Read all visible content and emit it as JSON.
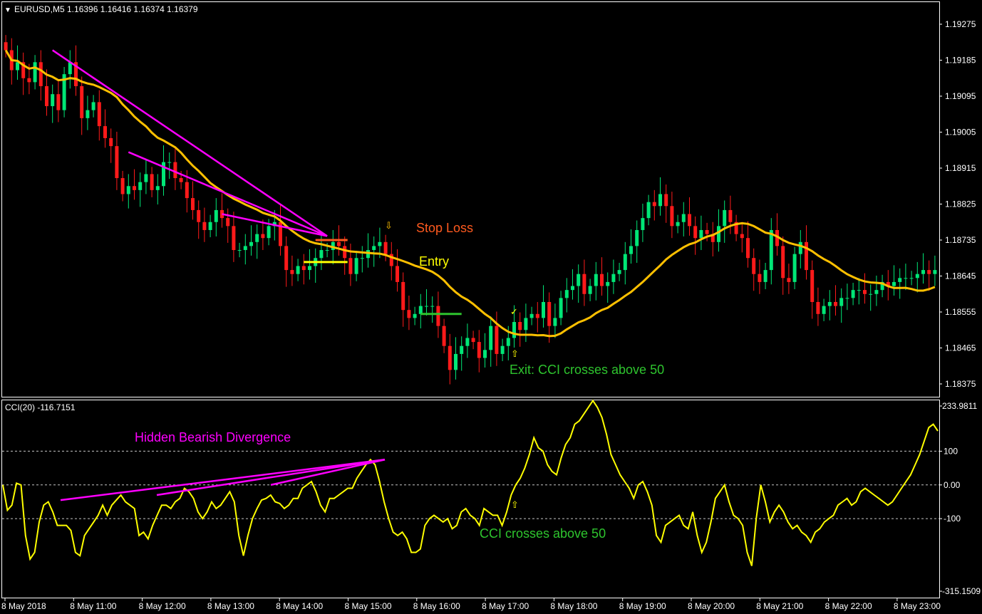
{
  "header": {
    "title": "EURUSD,M5  1.16396 1.16416 1.16374 1.16379",
    "title_arrow": "▼"
  },
  "colors": {
    "bull": "#00e676",
    "bear": "#ff1a1a",
    "ma": "#ffc000",
    "divergence": "#ff00ff",
    "cci": "#ffff00",
    "stop_loss": "#ff5a1f",
    "entry": "#ffff00",
    "exit": "#2ec42e",
    "levels": "#c8c8c8"
  },
  "annotations": {
    "stop_loss": "Stop Loss",
    "entry": "Entry",
    "exit": "Exit: CCI crosses above 50",
    "hidden_divergence": "Hidden Bearish Divergence",
    "cci_cross": "CCI crosses above 50",
    "down_arrow": "⇩",
    "up_arrow": "⇧",
    "check": "✓"
  },
  "chart_data": [
    {
      "type": "candlestick",
      "symbol": "EURUSD",
      "timeframe": "M5",
      "ohlc_header": {
        "open": 1.16396,
        "high": 1.16416,
        "low": 1.16374,
        "close": 1.16379
      },
      "price_axis_labels": [
        "1.19275",
        "1.19185",
        "1.19095",
        "1.19005",
        "1.18915",
        "1.18825",
        "1.18735",
        "1.18645",
        "1.18555",
        "1.18465",
        "1.18375"
      ],
      "time_axis_labels": [
        "8 May 2018",
        "8 May 11:00",
        "8 May 12:00",
        "8 May 13:00",
        "8 May 14:00",
        "8 May 15:00",
        "8 May 16:00",
        "8 May 17:00",
        "8 May 18:00",
        "8 May 19:00",
        "8 May 20:00",
        "8 May 21:00",
        "8 May 22:00",
        "8 May 23:00"
      ],
      "ylim": [
        1.1835,
        1.1935
      ],
      "closes": [
        1.1921,
        1.1916,
        1.1918,
        1.1914,
        1.1913,
        1.1918,
        1.1912,
        1.1907,
        1.191,
        1.1906,
        1.1915,
        1.1918,
        1.1912,
        1.1904,
        1.1906,
        1.1908,
        1.1902,
        1.1899,
        1.1897,
        1.1889,
        1.1885,
        1.1887,
        1.1886,
        1.1888,
        1.189,
        1.1886,
        1.1887,
        1.1893,
        1.1893,
        1.1889,
        1.1888,
        1.1884,
        1.1881,
        1.1878,
        1.1876,
        1.1878,
        1.1881,
        1.1879,
        1.1877,
        1.1871,
        1.1871,
        1.1872,
        1.1873,
        1.1875,
        1.1874,
        1.1877,
        1.1878,
        1.1872,
        1.1866,
        1.1865,
        1.1867,
        1.1866,
        1.1867,
        1.1869,
        1.1871,
        1.1871,
        1.1873,
        1.1872,
        1.1869,
        1.1865,
        1.1869,
        1.1869,
        1.1871,
        1.1872,
        1.1873,
        1.187,
        1.1867,
        1.1863,
        1.1856,
        1.1854,
        1.1855,
        1.1857,
        1.1857,
        1.1857,
        1.1852,
        1.1847,
        1.1841,
        1.1845,
        1.1847,
        1.1849,
        1.1848,
        1.1844,
        1.1846,
        1.1852,
        1.1845,
        1.1847,
        1.1849,
        1.1853,
        1.1851,
        1.1854,
        1.1855,
        1.1854,
        1.1858,
        1.1852,
        1.1854,
        1.1859,
        1.1861,
        1.1862,
        1.1865,
        1.186,
        1.1862,
        1.1865,
        1.1862,
        1.1863,
        1.1865,
        1.1866,
        1.187,
        1.1872,
        1.1876,
        1.1879,
        1.1883,
        1.1882,
        1.1885,
        1.1882,
        1.1877,
        1.1878,
        1.188,
        1.1877,
        1.1874,
        1.1876,
        1.1875,
        1.1873,
        1.1877,
        1.1881,
        1.1878,
        1.1875,
        1.1874,
        1.1869,
        1.1865,
        1.1863,
        1.1866,
        1.1876,
        1.1872,
        1.1864,
        1.1863,
        1.187,
        1.1873,
        1.1866,
        1.1858,
        1.1855,
        1.1857,
        1.1858,
        1.1857,
        1.1859,
        1.1859,
        1.1861,
        1.1861,
        1.186,
        1.186,
        1.1861,
        1.1863,
        1.1862,
        1.1863,
        1.1864,
        1.1864,
        1.1864,
        1.1865,
        1.1866,
        1.1865,
        1.1866
      ],
      "ma_label": "moving average",
      "divergence_trendlines": 3,
      "stop_loss_price": 1.18735,
      "entry_price": 1.1868,
      "exit_price": 1.1855
    },
    {
      "type": "line",
      "title": "CCI(20) -116.7151",
      "indicator": "CCI",
      "period": 20,
      "current_value": -116.7151,
      "axis_labels": [
        "233.9811",
        "100",
        "0.00",
        "-100",
        "-315.1509"
      ],
      "levels": [
        100,
        0,
        -100
      ],
      "ylim": [
        -315.1509,
        233.9811
      ],
      "values": [
        0,
        -75,
        -60,
        5,
        0,
        -150,
        -220,
        -200,
        -110,
        -60,
        -50,
        -80,
        -120,
        -120,
        -120,
        -135,
        -200,
        -210,
        -150,
        -130,
        -110,
        -90,
        -60,
        -90,
        -60,
        -45,
        -30,
        -50,
        -60,
        -70,
        -150,
        -140,
        -160,
        -120,
        -90,
        -60,
        -60,
        -70,
        -50,
        -40,
        -10,
        -20,
        -40,
        -80,
        -100,
        -80,
        -50,
        -70,
        -60,
        -40,
        -20,
        -50,
        -150,
        -210,
        -150,
        -100,
        -70,
        -45,
        -40,
        -30,
        -50,
        -55,
        -70,
        -60,
        -40,
        -40,
        -10,
        0,
        10,
        -20,
        -60,
        -80,
        -40,
        -40,
        -30,
        -20,
        -10,
        -10,
        20,
        40,
        60,
        75,
        60,
        10,
        -50,
        -100,
        -140,
        -150,
        -140,
        -160,
        -200,
        -200,
        -190,
        -120,
        -100,
        -90,
        -100,
        -110,
        -100,
        -130,
        -120,
        -80,
        -70,
        -90,
        -100,
        -120,
        -70,
        -80,
        -90,
        -90,
        -120,
        -80,
        -30,
        0,
        20,
        50,
        90,
        140,
        110,
        100,
        60,
        40,
        30,
        80,
        120,
        140,
        180,
        190,
        210,
        230,
        250,
        230,
        200,
        150,
        90,
        60,
        30,
        10,
        -10,
        -40,
        0,
        10,
        -20,
        -60,
        -150,
        -170,
        -120,
        -110,
        -100,
        -90,
        -120,
        -130,
        -80,
        -150,
        -200,
        -170,
        -110,
        -40,
        -20,
        0,
        -50,
        -90,
        -100,
        -120,
        -200,
        -240,
        -100,
        0,
        -50,
        -110,
        -80,
        -60,
        -80,
        -110,
        -130,
        -120,
        -140,
        -150,
        -170,
        -140,
        -130,
        -110,
        -100,
        -90,
        -60,
        -50,
        -40,
        -60,
        -50,
        -20,
        -10,
        -20,
        -30,
        -40,
        -50,
        -60,
        -50,
        -30,
        -10,
        10,
        30,
        60,
        90,
        130,
        170,
        180,
        160
      ]
    }
  ]
}
